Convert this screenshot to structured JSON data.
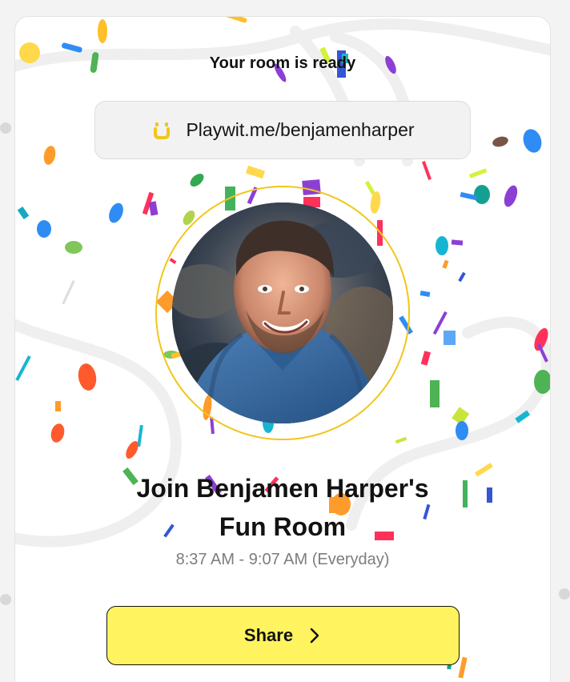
{
  "card": {
    "title": "Your room is ready"
  },
  "room_link": {
    "text": "Playwit.me/benjamenharper",
    "icon": "playwit-logo-icon"
  },
  "profile": {
    "avatar_alt": "Benjamen Harper profile photo",
    "ring_color": "#f1c61a"
  },
  "main": {
    "heading_line1": "Join Benjamen Harper's",
    "heading_line2": "Fun Room",
    "time": "8:37 AM - 9:07 AM (Everyday)"
  },
  "actions": {
    "share_label": "Share",
    "share_icon": "chevron-right-icon",
    "share_color": "#fff45f"
  }
}
